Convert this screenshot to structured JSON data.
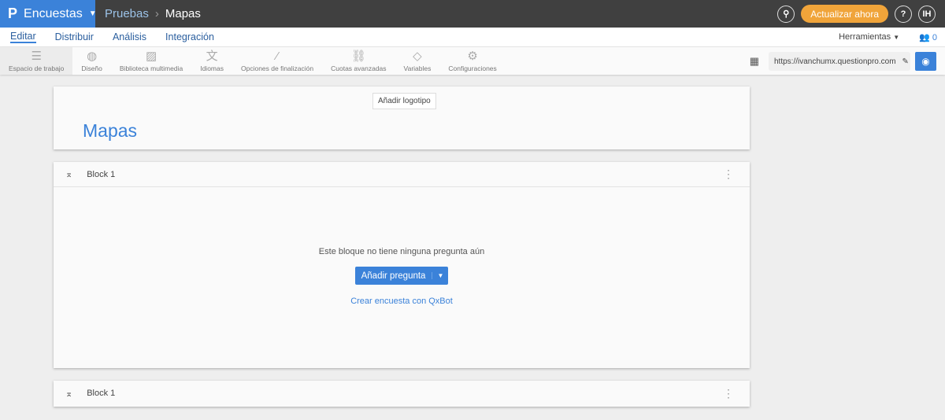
{
  "header": {
    "brand": "Encuestas",
    "breadcrumb": [
      "Pruebas",
      "Mapas"
    ],
    "upgrade": "Actualizar ahora",
    "help": "?",
    "avatar": "IH"
  },
  "nav": {
    "tabs": [
      "Editar",
      "Distribuir",
      "Análisis",
      "Integración"
    ],
    "tools": "Herramientas",
    "collab_count": "0"
  },
  "toolbar": {
    "items": [
      "Espacio de trabajo",
      "Diseño",
      "Biblioteca multimedia",
      "Idiomas",
      "Opciones de finalización",
      "Cuotas avanzadas",
      "Variables",
      "Configuraciones"
    ],
    "url": "https://ivanchumx.questionpro.com"
  },
  "survey": {
    "add_logo": "Añadir logotipo",
    "title": "Mapas"
  },
  "blocks": [
    {
      "name": "Block 1",
      "empty_text": "Este bloque no tiene ninguna pregunta aún",
      "add_question": "Añadir pregunta",
      "qxbot": "Crear encuesta con QxBot"
    },
    {
      "name": "Block 1"
    }
  ]
}
